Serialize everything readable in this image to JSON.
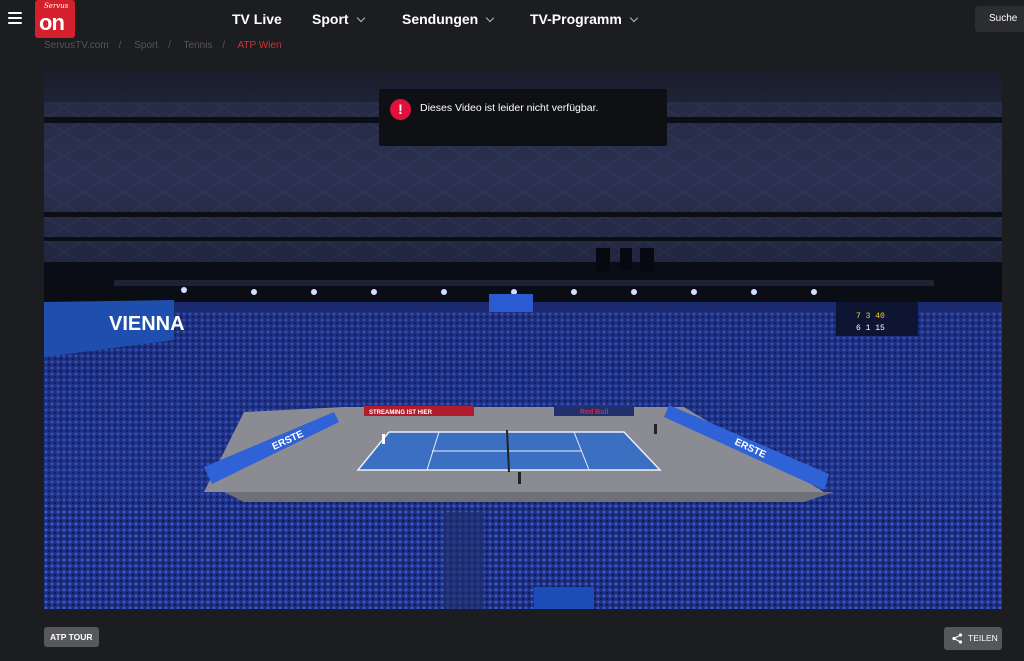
{
  "header": {
    "logo_small": "Servus",
    "logo_big": "on",
    "nav": [
      {
        "label": "TV Live",
        "dropdown": false
      },
      {
        "label": "Sport",
        "dropdown": true
      },
      {
        "label": "Sendungen",
        "dropdown": true
      },
      {
        "label": "TV-Programm",
        "dropdown": true
      }
    ],
    "search_label": "Suche"
  },
  "breadcrumb": [
    "ServusTV.com",
    "Sport",
    "Tennis",
    "ATP Wien"
  ],
  "player": {
    "error_message": "Dieses Video ist leider nicht verfügbar.",
    "error_icon": "!",
    "poster_banners": [
      "VIENNA",
      "ERSTE",
      "ERSTE",
      "STREAMING IST HIER",
      "Red Bull"
    ],
    "scoreboard": {
      "row1": "7 3 40",
      "row2": "6 1 15"
    }
  },
  "footer": {
    "tag_label": "ATP TOUR",
    "share_label": "TEILEN"
  },
  "colors": {
    "brand_red": "#d4202c",
    "error_red": "#e0113d",
    "court_blue": "#3a6fc1",
    "background": "#1c1d20"
  },
  "icons": [
    "hamburger-icon",
    "chevron-down-icon",
    "alert-icon",
    "share-icon"
  ]
}
